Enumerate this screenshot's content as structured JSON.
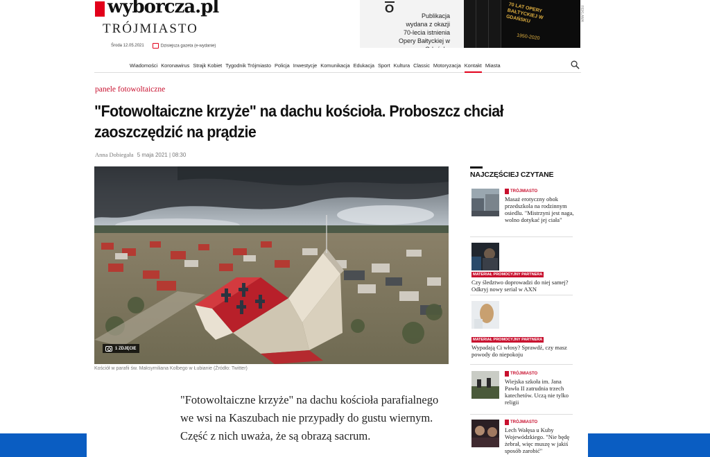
{
  "header": {
    "logo_text": "wyborcza.pl",
    "city": "TRÓJMIASTO",
    "date": "Środa 12.05.2021",
    "paper_link": "Dzisiejsza gazeta (e-wydanie)"
  },
  "ad": {
    "text_lines": [
      "Publikacja",
      "wydana z okazji",
      "70-lecia istnienia",
      "Opery Bałtyckiej w Gdańsku"
    ],
    "book_title": "70 LAT OPERY BAŁTYCKIEJ W GDAŃSKU",
    "book_years": "1950-2020",
    "label": "REKLAMA"
  },
  "nav": {
    "items": [
      "Wiadomości",
      "Koronawirus",
      "Strajk Kobiet",
      "Tygodnik Trójmiasto",
      "Policja",
      "Inwestycje",
      "Komunikacja",
      "Edukacja",
      "Sport",
      "Kultura",
      "Classic",
      "Motoryzacja",
      "Kontakt",
      "Miasta"
    ],
    "active": "Kontakt"
  },
  "article": {
    "section": "panele fotowoltaiczne",
    "headline": "\"Fotowoltaiczne krzyże\" na dachu kościoła. Proboszcz chciał zaoszczędzić na prądzie",
    "author": "Anna Dobiegała",
    "published": "5 maja 2021 | 08:30",
    "photo_badge": "1 ZDJĘCIE",
    "caption": "Kościół w parafii św. Maksymiliana Kolbego w Łubianie (Źródło: Twitter)",
    "lead": "\"Fotowoltaiczne krzyże\" na dachu kościoła parafialnego we wsi na Kaszubach nie przypadły do gustu wiernym. Część z nich uważa, że są obrazą sacrum."
  },
  "sidebar": {
    "title": "NAJCZĘŚCIEJ CZYTANE",
    "items": [
      {
        "category": "TRÓJMIASTO",
        "text": "Masaż erotyczny obok przedszkola na rodzinnym osiedlu. \"Mistrzyni jest naga, wolno dotykać jej ciała\"",
        "sponsored": false
      },
      {
        "category": "MATERIAŁ PROMOCYJNY PARTNERA",
        "text": "Czy śledztwo doprowadzi do niej samej? Odkryj nowy serial w AXN",
        "sponsored": true
      },
      {
        "category": "MATERIAŁ PROMOCYJNY PARTNERA",
        "text": "Wypadają Ci włosy? Sprawdź, czy masz powody do niepokoju",
        "sponsored": true
      },
      {
        "category": "TRÓJMIASTO",
        "text": "Wiejska szkoła im. Jana Pawła II zatrudnia trzech katechetów. Uczą nie tylko religii",
        "sponsored": false
      },
      {
        "category": "TRÓJMIASTO",
        "text": "Lech Wałęsa u Kuby Wojewódzkiego. \"Nie będę żebrał, więc muszę w jakiś sposób zarobić\"",
        "sponsored": false
      }
    ]
  },
  "colors": {
    "accent": "#e2001a",
    "section": "#c8102e",
    "bottom_bar": "#0a5dc2"
  }
}
